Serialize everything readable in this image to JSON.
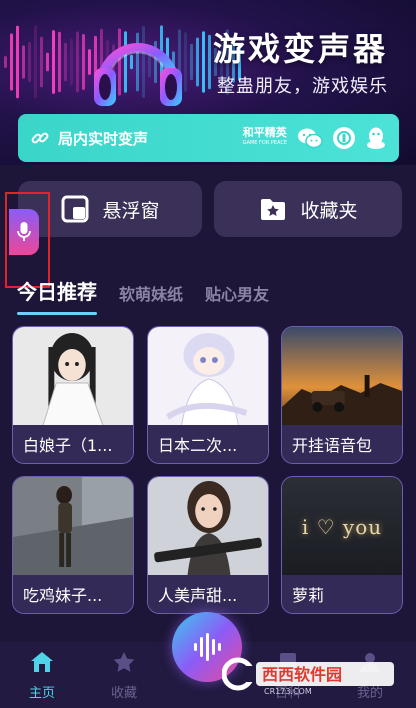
{
  "hero": {
    "title": "游戏变声器",
    "subtitle": "整蛊朋友，游戏娱乐"
  },
  "lan_bar": {
    "label": "局内实时变声",
    "pubg_logo_text": "和平精英",
    "pubg_logo_small": "GAME FOR PEACE",
    "icons": [
      "link-icon",
      "wechat-icon",
      "qq-icon",
      "tim-icon"
    ]
  },
  "features": {
    "float_window": "悬浮窗",
    "favorites": "收藏夹"
  },
  "tabs": [
    {
      "label": "今日推荐",
      "active": true
    },
    {
      "label": "软萌妹纸",
      "active": false
    },
    {
      "label": "贴心男友",
      "active": false
    }
  ],
  "cards": [
    {
      "label": "白娘子（1..."
    },
    {
      "label": "日本二次..."
    },
    {
      "label": "开挂语音包"
    },
    {
      "label": "吃鸡妹子..."
    },
    {
      "label": "人美声甜..."
    },
    {
      "label": "萝莉"
    }
  ],
  "card4_overlay": "i ♡ you",
  "bottom_nav": {
    "home": "主页",
    "favorites": "收藏",
    "item3": "百科",
    "item4": "我的"
  },
  "watermark": {
    "brand": "西西软件园",
    "url": "CR173.COM"
  },
  "colors": {
    "accent_cyan": "#4fd3e8",
    "lan_bar": "#3ad6c9",
    "highlight_box": "#e0242e"
  }
}
